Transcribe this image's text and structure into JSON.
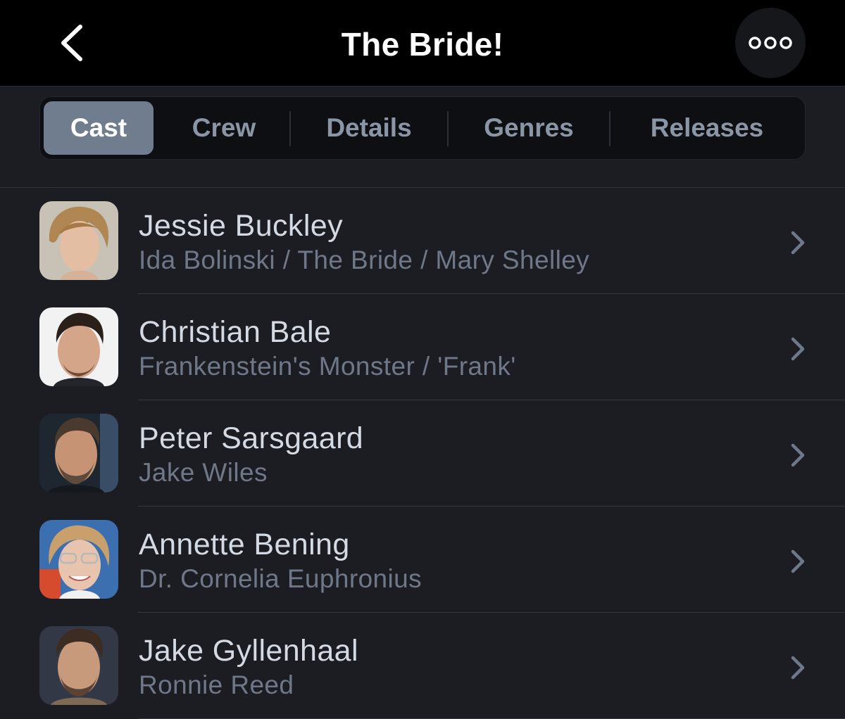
{
  "header": {
    "title": "The Bride!",
    "back_icon": "chevron-left-icon",
    "more_icon": "ellipsis-icon"
  },
  "tabs": [
    {
      "label": "Cast",
      "active": true
    },
    {
      "label": "Crew",
      "active": false
    },
    {
      "label": "Details",
      "active": false
    },
    {
      "label": "Genres",
      "active": false
    },
    {
      "label": "Releases",
      "active": false
    }
  ],
  "cast": [
    {
      "name": "Jessie Buckley",
      "role": "Ida Bolinski / The Bride / Mary Shelley"
    },
    {
      "name": "Christian Bale",
      "role": "Frankenstein's Monster / 'Frank'"
    },
    {
      "name": "Peter Sarsgaard",
      "role": "Jake Wiles"
    },
    {
      "name": "Annette Bening",
      "role": "Dr. Cornelia Euphronius"
    },
    {
      "name": "Jake Gyllenhaal",
      "role": "Ronnie Reed"
    }
  ],
  "colors": {
    "background": "#1b1d22",
    "header": "#000000",
    "active_tab": "#6f7d8f",
    "tab_text": "#8a95a6",
    "name_text": "#d4dae4",
    "role_text": "#6f7888"
  }
}
